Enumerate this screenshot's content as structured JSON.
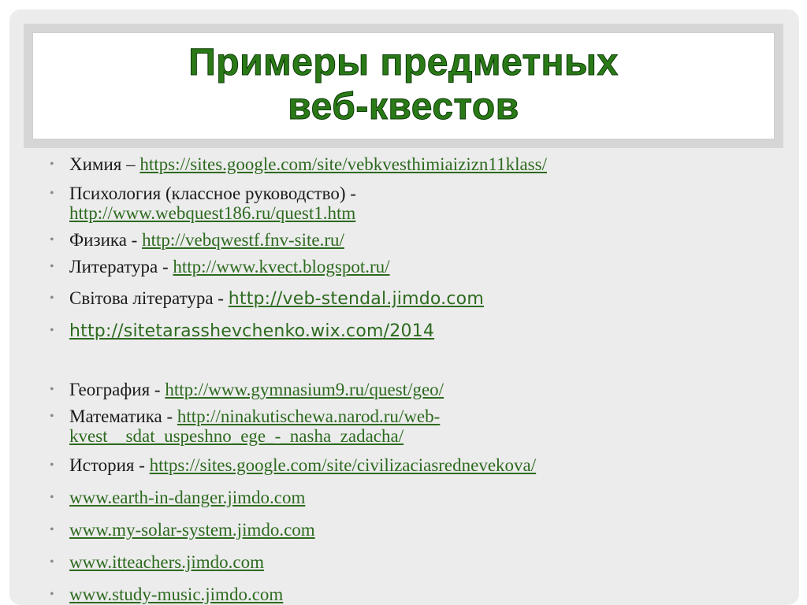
{
  "title": {
    "line1": "Примеры предметных",
    "line2": "веб-квестов"
  },
  "items": [
    {
      "label": "Химия – ",
      "url": "https://sites.google.com/site/vebkvesthimiaizizn11klass/"
    },
    {
      "label": "Психология (классное руководство) -",
      "url": "http://www.webquest186.ru/quest1.htm"
    },
    {
      "label": "Физика - ",
      "url": "http://vebqwestf.fnv-site.ru/"
    },
    {
      "label": "Литература - ",
      "url": "http://www.kvect.blogspot.ru/"
    },
    {
      "label": "Світова література - ",
      "url": "http://veb-stendal.jimdo.com"
    },
    {
      "label": "",
      "url": "http://sitetarasshevchenko.wix.com/2014"
    },
    {
      "label": "География - ",
      "url": "http://www.gymnasium9.ru/quest/geo/"
    },
    {
      "label": "Математика - ",
      "url_part1": "http://ninakutischewa.narod.ru/web-",
      "url_part2": "kvest__sdat_uspeshno_ege_-_nasha_zadacha/"
    },
    {
      "label": "История - ",
      "url": "https://sites.google.com/site/civilizaciasrednevekova/"
    },
    {
      "label": "",
      "url": "www.earth-in-danger.jimdo.com"
    },
    {
      "label": "",
      "url": "www.my-solar-system.jimdo.com"
    },
    {
      "label": "",
      "url": "www.itteachers.jimdo.com"
    },
    {
      "label": "",
      "url": "www.study-music.jimdo.com"
    }
  ],
  "colors": {
    "title": "#2a7a17",
    "link": "#2d6a1f",
    "bullet": "#8a8a8a"
  }
}
